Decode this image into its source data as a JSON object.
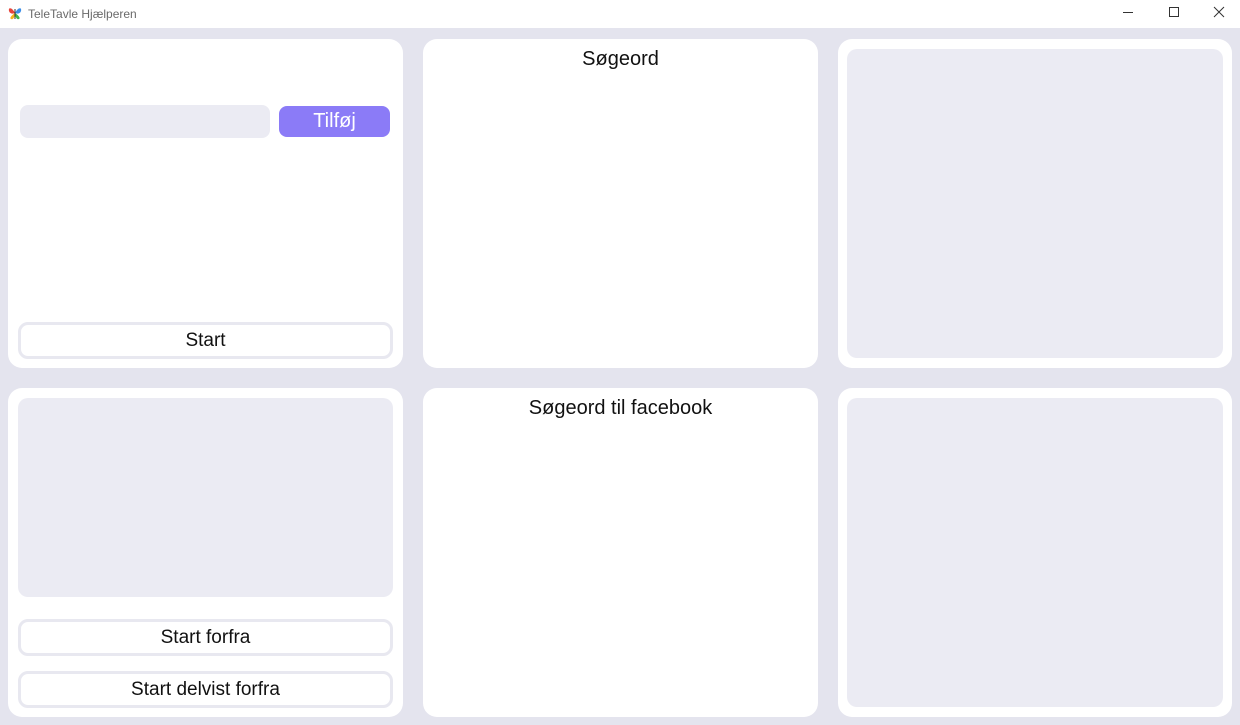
{
  "window": {
    "title": "TeleTavle Hjælperen",
    "icon": "butterfly-app-icon",
    "controls": [
      "minimize-icon",
      "maximize-icon",
      "close-icon"
    ]
  },
  "add_panel": {
    "input_value": "",
    "input_placeholder": "",
    "add_label": "Tilføj",
    "start_label": "Start"
  },
  "keywords_panel": {
    "heading": "Søgeord"
  },
  "restart_panel": {
    "start_over_label": "Start forfra",
    "partial_restart_label": "Start delvist forfra"
  },
  "facebook_panel": {
    "heading": "Søgeord til facebook"
  },
  "colors": {
    "background": "#e4e4ee",
    "panel": "#ffffff",
    "field": "#ebebf3",
    "accent": "#8b7bf7"
  }
}
